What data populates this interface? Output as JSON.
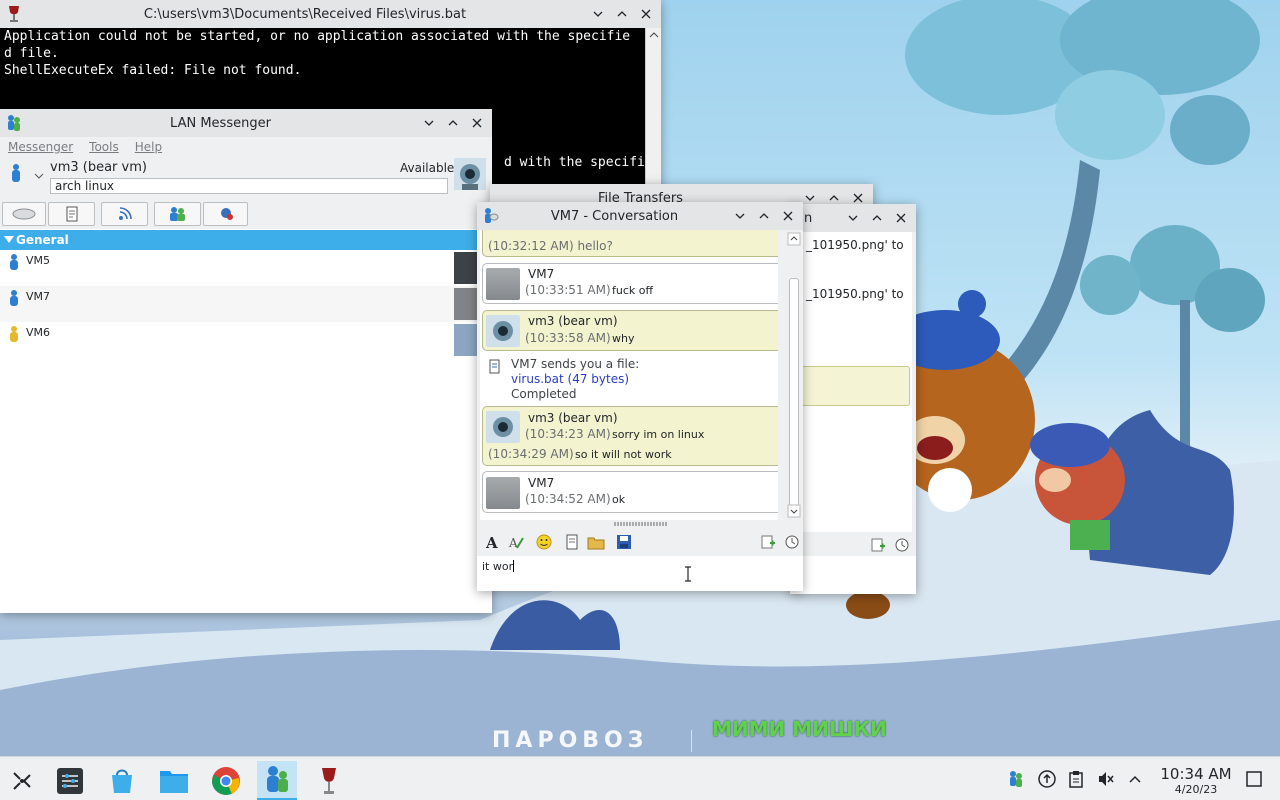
{
  "terminal": {
    "title": "C:\\users\\vm3\\Documents\\Received Files\\virus.bat",
    "lines": [
      "Application could not be started, or no application associated with the specifie",
      "d file.",
      "ShellExecuteEx failed: File not found.",
      "",
      "",
      "",
      "",
      "d with the specifie"
    ]
  },
  "messenger": {
    "title": "LAN Messenger",
    "menu": [
      "Messenger",
      "Tools",
      "Help"
    ],
    "user_name": "vm3 (bear vm)",
    "status": "Available",
    "note": "arch linux",
    "group": "General",
    "contacts": [
      "VM5",
      "VM7",
      "VM6"
    ]
  },
  "file_transfers": {
    "title": "File Transfers",
    "rows": [
      "_101950.png' to",
      "_101950.png' to"
    ]
  },
  "conversation": {
    "title": "VM7 - Conversation",
    "partial_line": "(10:32:12 AM) hello?",
    "messages": [
      {
        "name": "VM7",
        "time": "(10:33:51 AM)",
        "text": "fuck off"
      },
      {
        "name": "vm3 (bear vm)",
        "time": "(10:33:58 AM)",
        "text": "why"
      },
      {
        "name": "vm3 (bear vm)",
        "time": "(10:34:23 AM)",
        "text": "sorry im on linux",
        "time2": "(10:34:29 AM)",
        "text2": "so it will not work"
      },
      {
        "name": "VM7",
        "time": "(10:34:52 AM)",
        "text": "ok"
      }
    ],
    "file_notice": {
      "line1": "VM7 sends you a file:",
      "file": "virus.bat (47 bytes)",
      "status": "Completed"
    },
    "input_text": "it wor"
  },
  "taskbar": {
    "time": "10:34 AM",
    "date": "4/20/23"
  },
  "wallpaper": {
    "brand_left": "ПАРОВОЗ",
    "brand_right": "МИМИ МИШКИ"
  },
  "colors": {
    "accent": "#3daee9",
    "bubble_mine": "#f3f3d0",
    "link": "#2a3fbe"
  }
}
